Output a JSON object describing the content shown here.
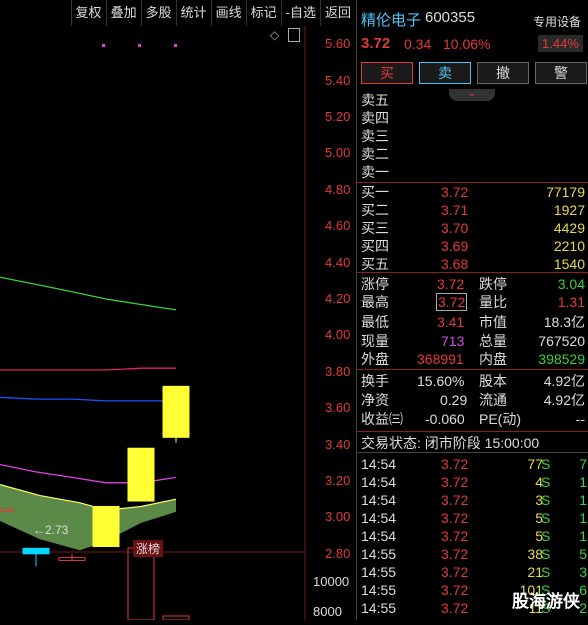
{
  "toolbar": [
    "复权",
    "叠加",
    "多股",
    "统计",
    "画线",
    "标记",
    "-自选",
    "返回"
  ],
  "stock": {
    "name": "精伦电子",
    "code": "600355",
    "price": "3.72",
    "change": "0.34",
    "change_pct": "10.06%",
    "device_label": "专用设备",
    "device_pct": "1.44%"
  },
  "trade_buttons": [
    "买",
    "卖",
    "撤",
    "警"
  ],
  "collapse_icon": "chevron-down-double",
  "asks": [
    {
      "label": "卖五",
      "price": "",
      "vol": ""
    },
    {
      "label": "卖四",
      "price": "",
      "vol": ""
    },
    {
      "label": "卖三",
      "price": "",
      "vol": ""
    },
    {
      "label": "卖二",
      "price": "",
      "vol": ""
    },
    {
      "label": "卖一",
      "price": "",
      "vol": ""
    }
  ],
  "bids": [
    {
      "label": "买一",
      "price": "3.72",
      "vol": "77179"
    },
    {
      "label": "买二",
      "price": "3.71",
      "vol": "1927"
    },
    {
      "label": "买三",
      "price": "3.70",
      "vol": "4429"
    },
    {
      "label": "买四",
      "price": "3.69",
      "vol": "2210"
    },
    {
      "label": "买五",
      "price": "3.68",
      "vol": "1540"
    }
  ],
  "stats": {
    "zhangting_label": "涨停",
    "zhangting": "3.72",
    "dieting_label": "跌停",
    "dieting": "3.04",
    "high_label": "最高",
    "high": "3.72",
    "liangbi_label": "量比",
    "liangbi": "1.31",
    "low_label": "最低",
    "low": "3.41",
    "mktval_label": "市值",
    "mktval": "18.3亿",
    "now_label": "现量",
    "now": "713",
    "total_label": "总量",
    "total": "767520",
    "outer_label": "外盘",
    "outer": "368991",
    "inner_label": "内盘",
    "inner": "398529",
    "turnover_label": "换手",
    "turnover": "15.60%",
    "shares_label": "股本",
    "shares": "4.92亿",
    "nav_label": "净资",
    "nav": "0.29",
    "float_label": "流通",
    "float": "4.92亿",
    "eps_label": "收益㈢",
    "eps": "-0.060",
    "pe_label": "PE(动)",
    "pe": "--"
  },
  "status": "交易状态: 闭市阶段 15:00:00",
  "ticks": [
    {
      "time": "14:54",
      "price": "3.72",
      "vol": "77",
      "side": "S",
      "n": "7"
    },
    {
      "time": "14:54",
      "price": "3.72",
      "vol": "4",
      "side": "S",
      "n": "1"
    },
    {
      "time": "14:54",
      "price": "3.72",
      "vol": "3",
      "side": "S",
      "n": "1"
    },
    {
      "time": "14:54",
      "price": "3.72",
      "vol": "5",
      "side": "S",
      "n": "1"
    },
    {
      "time": "14:54",
      "price": "3.72",
      "vol": "5",
      "side": "S",
      "n": "1"
    },
    {
      "time": "14:55",
      "price": "3.72",
      "vol": "38",
      "side": "S",
      "n": "5"
    },
    {
      "time": "14:55",
      "price": "3.72",
      "vol": "21",
      "side": "S",
      "n": "3"
    },
    {
      "time": "14:55",
      "price": "3.72",
      "vol": "101",
      "side": "S",
      "n": "6"
    },
    {
      "time": "14:55",
      "price": "3.72",
      "vol": "11",
      "side": "S",
      "n": "2"
    }
  ],
  "watermark": "股海游侠",
  "chart": {
    "price_ticks": [
      "5.60",
      "5.40",
      "5.20",
      "5.00",
      "4.80",
      "4.60",
      "4.40",
      "4.20",
      "4.00",
      "3.80",
      "3.60",
      "3.40",
      "3.20",
      "3.00",
      "2.80"
    ],
    "vol_ticks": [
      "10000",
      "8000"
    ],
    "low_annotation": "←2.73",
    "tag_label": "涨榜",
    "colors": {
      "up_limit": "#ffff33",
      "down": "#00d8ff",
      "ma_green": "#3ad13a",
      "ma_red": "#e0205a",
      "ma_blue": "#2050ff",
      "ma_magenta": "#e040e0"
    }
  },
  "chart_data": {
    "type": "candlestick",
    "candles": [
      {
        "open": 3.05,
        "close": 3.05,
        "high": 3.05,
        "low": 3.05,
        "color": "red-flat"
      },
      {
        "open": 2.83,
        "close": 2.8,
        "high": 2.83,
        "low": 2.73,
        "color": "cyan"
      },
      {
        "open": 2.78,
        "close": 2.78,
        "high": 2.8,
        "low": 2.76,
        "color": "red-flat"
      },
      {
        "open": 2.84,
        "close": 3.06,
        "high": 3.06,
        "low": 2.84,
        "color": "yellow"
      },
      {
        "open": 3.09,
        "close": 3.38,
        "high": 3.38,
        "low": 3.09,
        "color": "yellow"
      },
      {
        "open": 3.44,
        "close": 3.72,
        "high": 3.72,
        "low": 3.41,
        "color": "yellow"
      }
    ],
    "ma_lines": {
      "green": [
        4.32,
        4.28,
        4.24,
        4.2,
        4.17,
        4.14
      ],
      "red": [
        3.81,
        3.81,
        3.81,
        3.81,
        3.82,
        3.82
      ],
      "blue": [
        3.66,
        3.65,
        3.65,
        3.64,
        3.64,
        3.64
      ],
      "magenta": [
        3.29,
        3.25,
        3.22,
        3.19,
        3.19,
        3.22
      ]
    },
    "ylim": [
      2.7,
      5.7
    ]
  }
}
